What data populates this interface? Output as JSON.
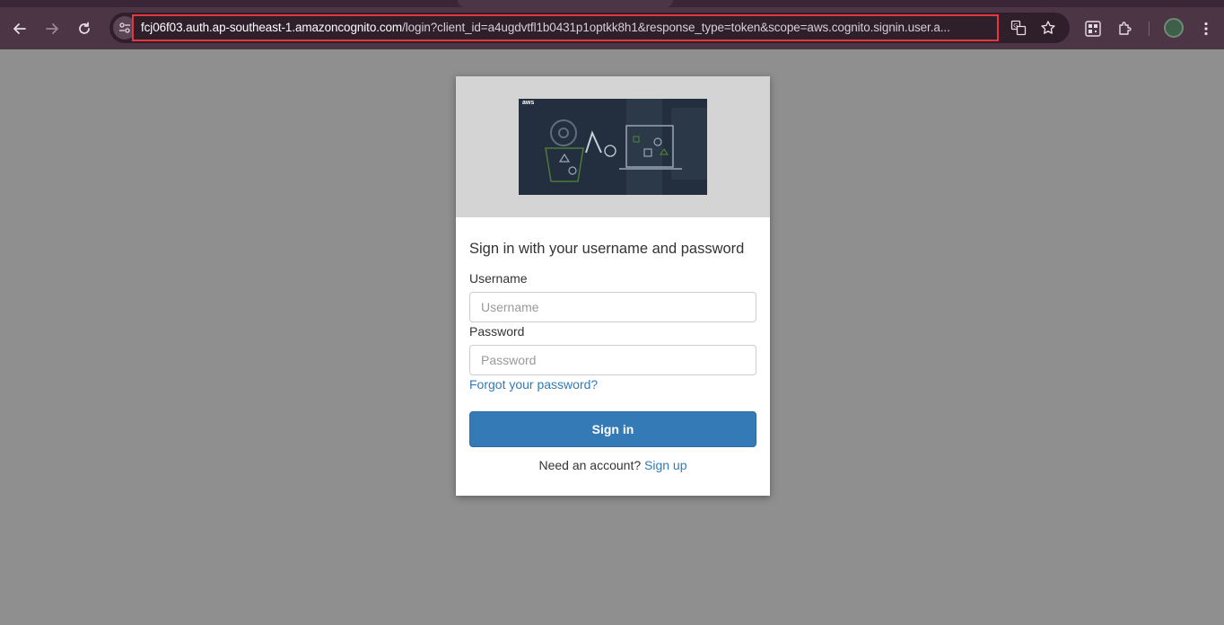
{
  "browser": {
    "url_host": "fcj06f03.auth.ap-southeast-1.amazoncognito.com",
    "url_rest": "/login?client_id=a4ugdvtfl1b0431p1optkk8h1&response_type=token&scope=aws.cognito.signin.user.a...",
    "icons": [
      "back-icon",
      "forward-icon",
      "reload-icon",
      "site-info-icon",
      "translate-icon",
      "bookmark-star-icon",
      "qr-code-icon",
      "extensions-icon",
      "profile-avatar",
      "menu-icon"
    ]
  },
  "login": {
    "banner_logo_text": "aws",
    "heading": "Sign in with your username and password",
    "username_label": "Username",
    "username_placeholder": "Username",
    "username_value": "",
    "password_label": "Password",
    "password_placeholder": "Password",
    "password_value": "",
    "forgot_link": "Forgot your password?",
    "signin_button": "Sign in",
    "signup_prompt": "Need an account?",
    "signup_link": "Sign up"
  },
  "colors": {
    "primary_button": "#337ab7",
    "link": "#337ab7",
    "url_highlight_border": "#e8363f",
    "page_overlay": "#8f8f8f",
    "browser_frame": "#4c3545"
  }
}
